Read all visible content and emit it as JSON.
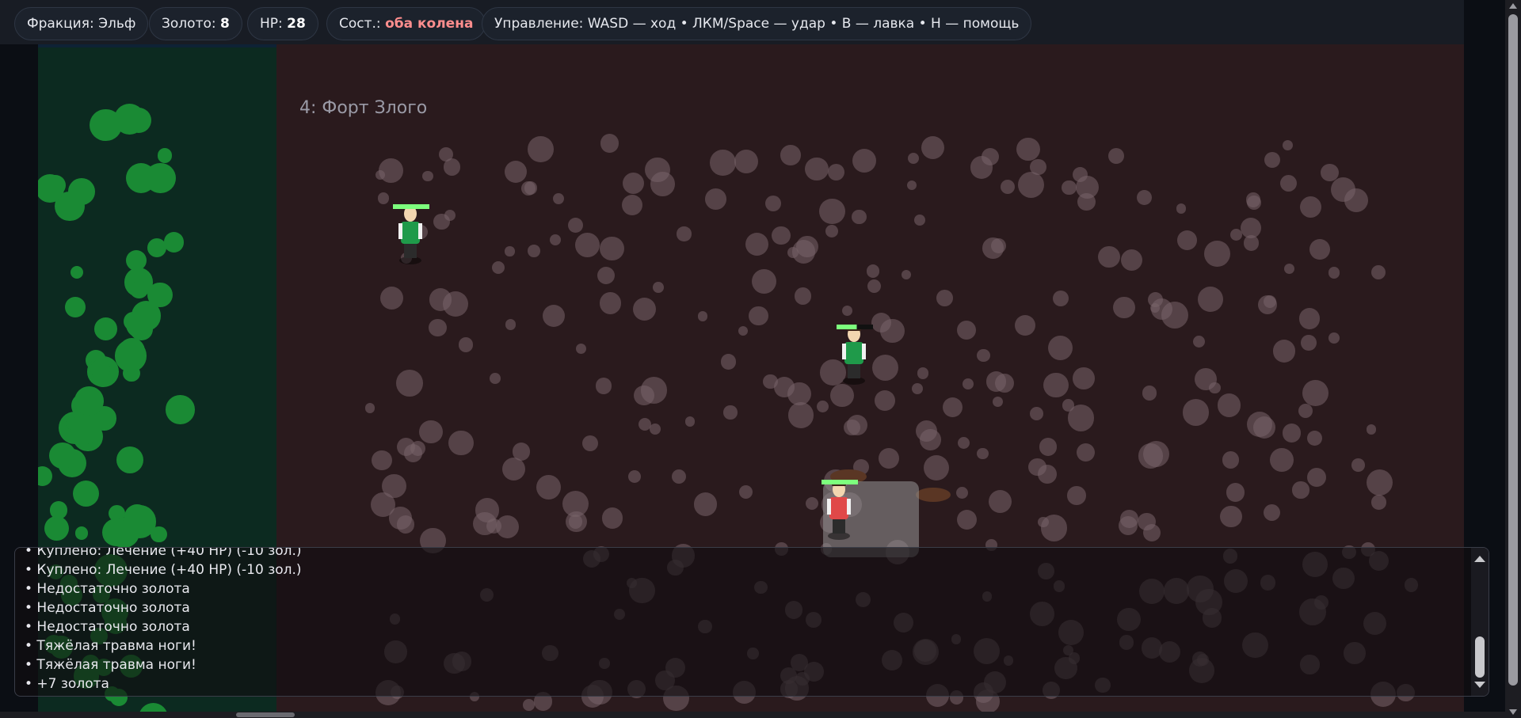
{
  "hud": {
    "faction": "Фракция: Эльф",
    "gold_label": "Золото:",
    "gold_value": "8",
    "hp_label": "HP:",
    "hp_value": "28",
    "state_label": "Сост.:",
    "state_value": "оба колена",
    "controls": "Управление: WASD — ход • ЛКМ/Space — удар • B — лавка • H — помощь"
  },
  "zone": {
    "title": "4: Форт Злого"
  },
  "log": {
    "lines": [
      "• Куплено: Лечение (+40 HP) (-10 зол.)",
      "• Куплено: Лечение (+40 HP) (-10 зол.)",
      "• Недостаточно золота",
      "• Недостаточно золота",
      "• Недостаточно золота",
      "• Тяжёлая травма ноги!",
      "• Тяжёлая травма ноги!",
      "• +7 золота"
    ]
  },
  "colors": {
    "world_background": "#2a1a1d",
    "forest": "#0c2a20",
    "tree": "#1a8a34",
    "hp_bar": "#7dff7d",
    "ally_tunic": "#1f9a4a",
    "player_tunic": "#e04848",
    "state_warning": "#ff8e8e"
  },
  "icons": {
    "shop_zone": "shop-area",
    "log_scroll_up": "chevron-up-icon",
    "log_scroll_down": "chevron-down-icon"
  }
}
